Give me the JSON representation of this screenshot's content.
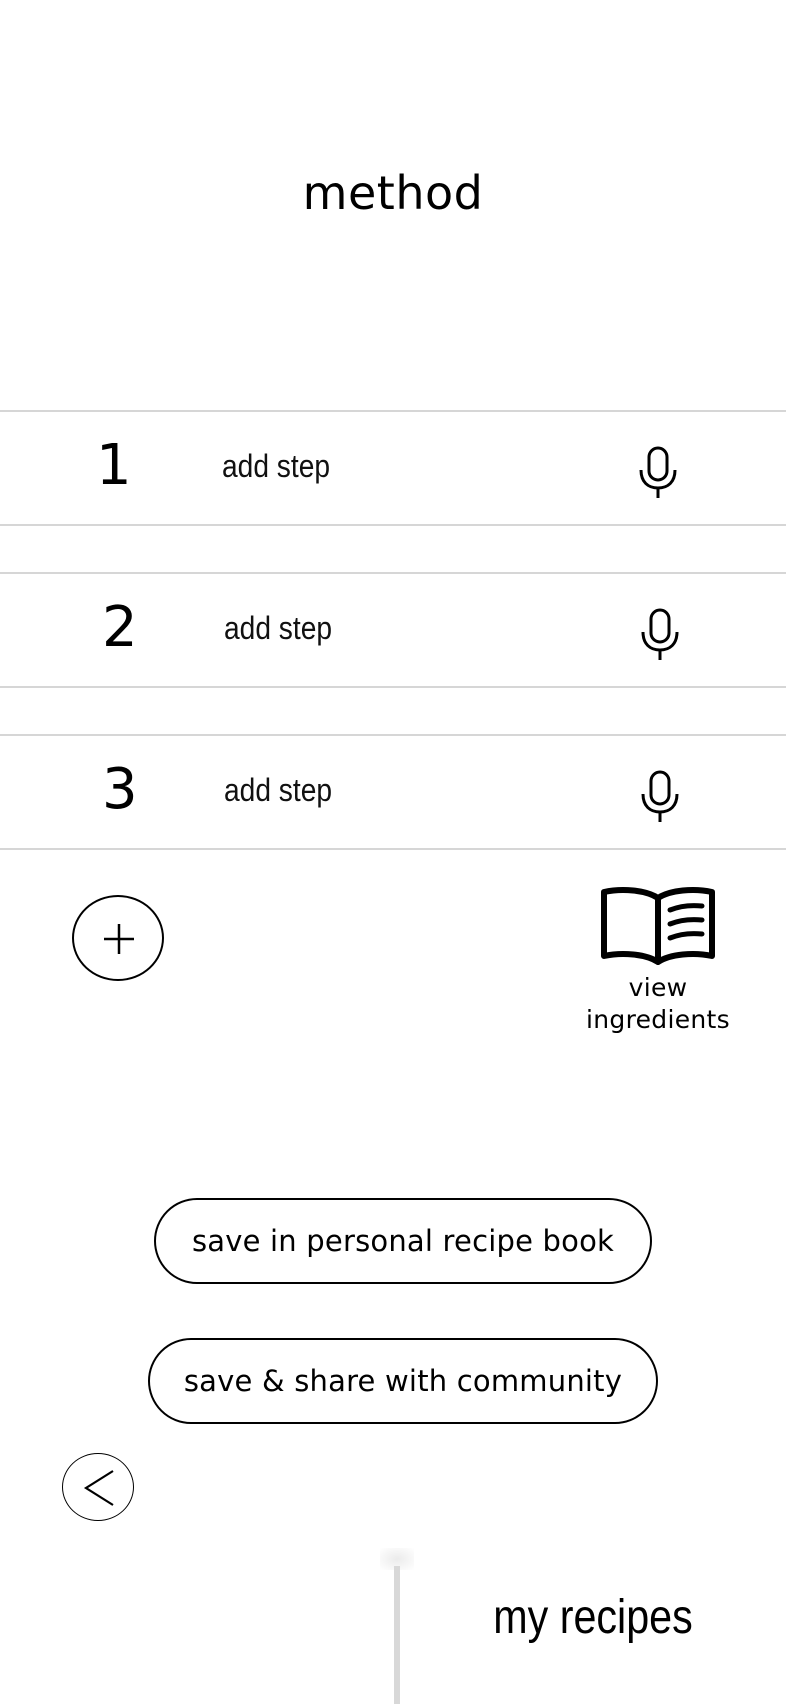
{
  "page": {
    "title": "method"
  },
  "steps": [
    {
      "number": "1",
      "placeholder": "add step",
      "mic_icon": "microphone-icon"
    },
    {
      "number": "2",
      "placeholder": "add step",
      "mic_icon": "microphone-icon"
    },
    {
      "number": "3",
      "placeholder": "add step",
      "mic_icon": "microphone-icon"
    }
  ],
  "actions": {
    "add_step_icon": "plus-icon",
    "view_ingredients": {
      "icon": "open-book-icon",
      "line1": "view",
      "line2": "ingredients"
    },
    "save_personal": "save in personal recipe book",
    "save_share": "save & share with community",
    "back_icon": "chevron-left-icon"
  },
  "tabs": {
    "my_recipes": "my recipes"
  }
}
